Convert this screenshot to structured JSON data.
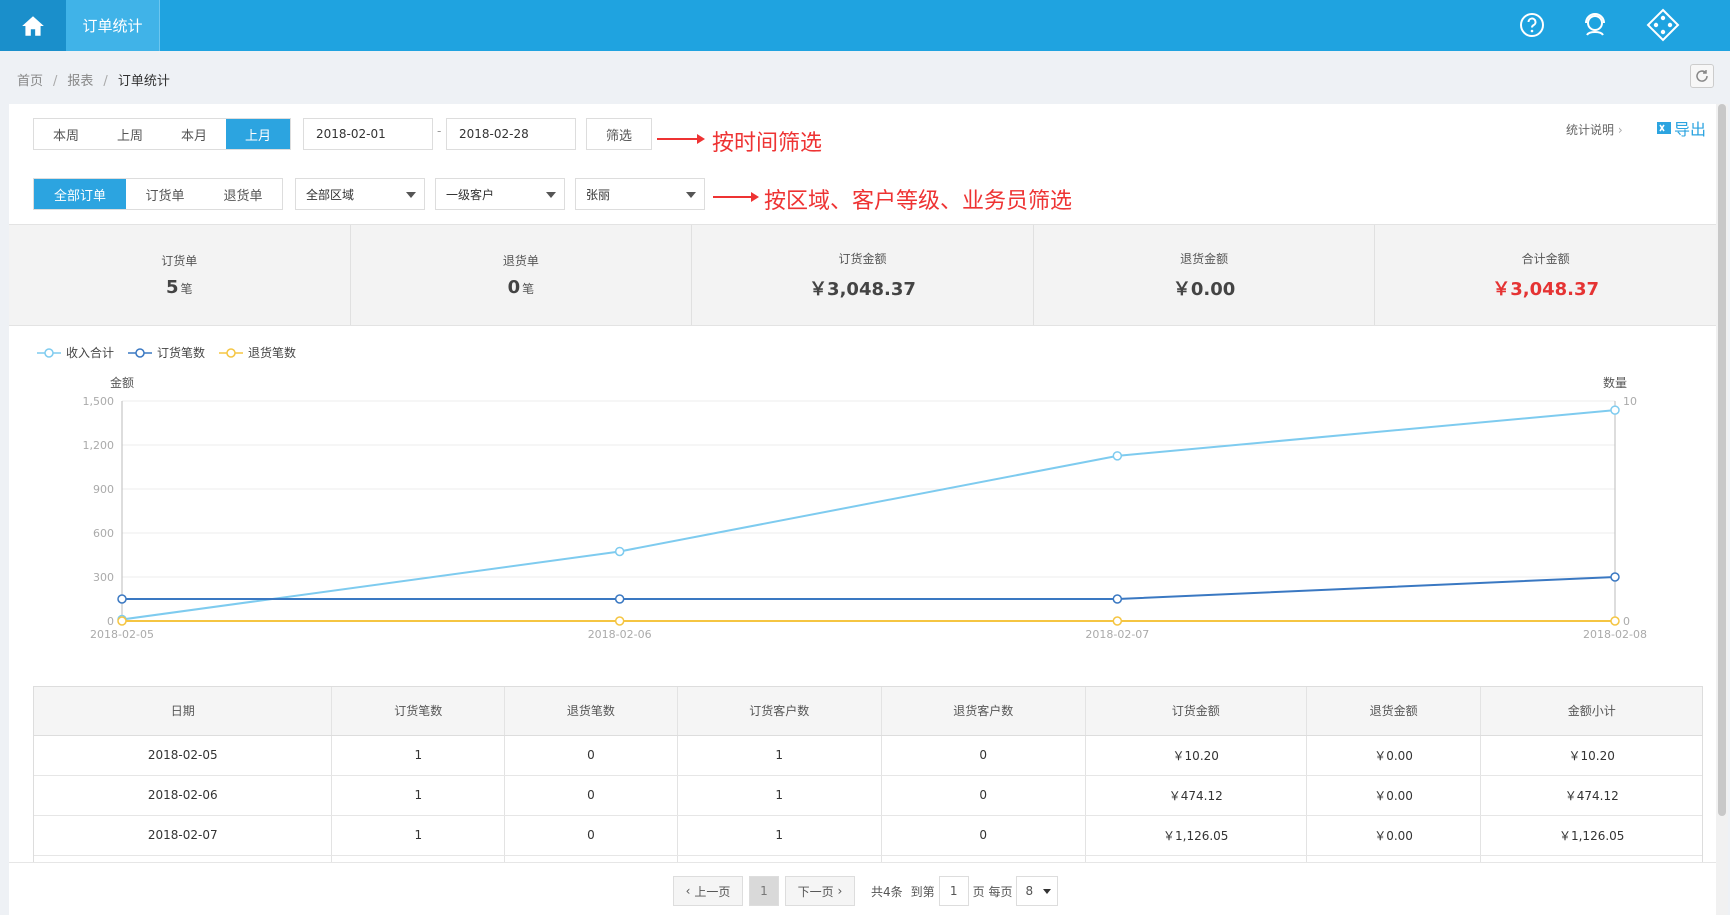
{
  "topbar": {
    "tab_label": "订单统计",
    "icons": [
      "home-icon",
      "help-icon",
      "service-icon",
      "app-grid-icon"
    ]
  },
  "breadcrumb": {
    "home": "首页",
    "reports": "报表",
    "current": "订单统计",
    "separator": "/"
  },
  "filters": {
    "period_tabs": [
      {
        "label": "本周",
        "active": false
      },
      {
        "label": "上周",
        "active": false
      },
      {
        "label": "本月",
        "active": false
      },
      {
        "label": "上月",
        "active": true
      }
    ],
    "start_date": "2018-02-01",
    "end_date": "2018-02-28",
    "date_separator": "-",
    "filter_button": "筛选",
    "annotation_time": "按时间筛选",
    "order_type_tabs": [
      {
        "label": "全部订单",
        "active": true
      },
      {
        "label": "订货单",
        "active": false
      },
      {
        "label": "退货单",
        "active": false
      }
    ],
    "region_select": "全部区域",
    "customer_level_select": "一级客户",
    "salesman_select": "张丽",
    "annotation_region": "按区域、客户等级、业务员筛选",
    "help_link": "统计说明",
    "export_label": "导出"
  },
  "summary": [
    {
      "label": "订货单",
      "value": "5",
      "unit": "笔"
    },
    {
      "label": "退货单",
      "value": "0",
      "unit": "笔"
    },
    {
      "label": "订货金额",
      "value": "￥3,048.37",
      "unit": ""
    },
    {
      "label": "退货金额",
      "value": "￥0.00",
      "unit": ""
    },
    {
      "label": "合计金额",
      "value": "￥3,048.37",
      "unit": "",
      "highlight": true
    }
  ],
  "chart_data": {
    "type": "line",
    "x": [
      "2018-02-05",
      "2018-02-06",
      "2018-02-07",
      "2018-02-08"
    ],
    "ylabel": "金额",
    "y2label": "数量",
    "ylim": [
      0,
      1500
    ],
    "y_ticks": [
      0,
      300,
      600,
      900,
      1200,
      1500
    ],
    "y_tick_labels": [
      "0",
      "300",
      "600",
      "900",
      "1,200",
      "1,500"
    ],
    "y2lim": [
      0,
      10
    ],
    "y2_ticks": [
      0,
      10
    ],
    "legend_position": "top-left",
    "series": [
      {
        "name": "收入合计",
        "axis": "left",
        "color": "#7ecbef",
        "values": [
          10.2,
          474.12,
          1126.05,
          1438
        ]
      },
      {
        "name": "订货笔数",
        "axis": "right",
        "color": "#3a78c2",
        "values": [
          1,
          1,
          1,
          2
        ]
      },
      {
        "name": "退货笔数",
        "axis": "right",
        "color": "#f5c542",
        "values": [
          0,
          0,
          0,
          0
        ]
      }
    ]
  },
  "table": {
    "headers": [
      "日期",
      "订货笔数",
      "退货笔数",
      "订货客户数",
      "退货客户数",
      "订货金额",
      "退货金额",
      "金额小计"
    ],
    "rows": [
      [
        "2018-02-05",
        "1",
        "0",
        "1",
        "0",
        "￥10.20",
        "￥0.00",
        "￥10.20"
      ],
      [
        "2018-02-06",
        "1",
        "0",
        "1",
        "0",
        "￥474.12",
        "￥0.00",
        "￥474.12"
      ],
      [
        "2018-02-07",
        "1",
        "0",
        "1",
        "0",
        "￥1,126.05",
        "￥0.00",
        "￥1,126.05"
      ],
      [
        "",
        "",
        "",
        "",
        "",
        "",
        "",
        ""
      ]
    ]
  },
  "pager": {
    "prev": "上一页",
    "current_page": "1",
    "next": "下一页",
    "total": "共4条",
    "goto_prefix": "到第",
    "goto_value": "1",
    "goto_suffix": "页 每页",
    "page_size": "8"
  },
  "colors": {
    "primary": "#1fa3e0",
    "active_tab": "#2ca4e0",
    "annotation": "#e33333",
    "highlight": "#e53333"
  }
}
